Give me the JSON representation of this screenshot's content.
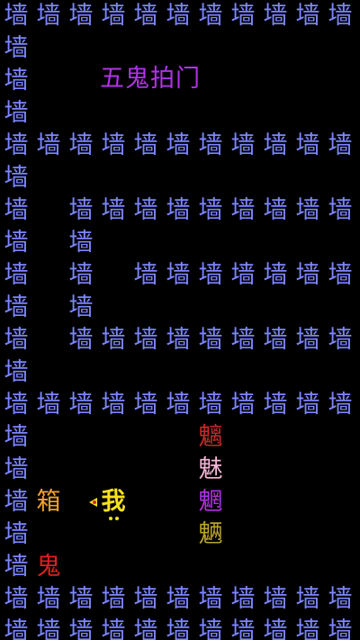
{
  "title": "五鬼拍门",
  "wall_char": "墙",
  "walls": [
    [
      0,
      0
    ],
    [
      1,
      0
    ],
    [
      2,
      0
    ],
    [
      3,
      0
    ],
    [
      4,
      0
    ],
    [
      5,
      0
    ],
    [
      6,
      0
    ],
    [
      7,
      0
    ],
    [
      8,
      0
    ],
    [
      9,
      0
    ],
    [
      10,
      0
    ],
    [
      0,
      1
    ],
    [
      0,
      2
    ],
    [
      0,
      3
    ],
    [
      0,
      4
    ],
    [
      1,
      4
    ],
    [
      2,
      4
    ],
    [
      3,
      4
    ],
    [
      4,
      4
    ],
    [
      5,
      4
    ],
    [
      6,
      4
    ],
    [
      7,
      4
    ],
    [
      8,
      4
    ],
    [
      9,
      4
    ],
    [
      10,
      4
    ],
    [
      0,
      5
    ],
    [
      0,
      6
    ],
    [
      2,
      6
    ],
    [
      3,
      6
    ],
    [
      4,
      6
    ],
    [
      5,
      6
    ],
    [
      6,
      6
    ],
    [
      7,
      6
    ],
    [
      8,
      6
    ],
    [
      9,
      6
    ],
    [
      10,
      6
    ],
    [
      0,
      7
    ],
    [
      2,
      7
    ],
    [
      0,
      8
    ],
    [
      2,
      8
    ],
    [
      4,
      8
    ],
    [
      5,
      8
    ],
    [
      6,
      8
    ],
    [
      7,
      8
    ],
    [
      8,
      8
    ],
    [
      9,
      8
    ],
    [
      10,
      8
    ],
    [
      0,
      9
    ],
    [
      2,
      9
    ],
    [
      0,
      10
    ],
    [
      2,
      10
    ],
    [
      3,
      10
    ],
    [
      4,
      10
    ],
    [
      5,
      10
    ],
    [
      6,
      10
    ],
    [
      7,
      10
    ],
    [
      8,
      10
    ],
    [
      9,
      10
    ],
    [
      10,
      10
    ],
    [
      0,
      11
    ],
    [
      0,
      12
    ],
    [
      1,
      12
    ],
    [
      2,
      12
    ],
    [
      3,
      12
    ],
    [
      4,
      12
    ],
    [
      5,
      12
    ],
    [
      6,
      12
    ],
    [
      7,
      12
    ],
    [
      8,
      12
    ],
    [
      9,
      12
    ],
    [
      10,
      12
    ],
    [
      0,
      13
    ],
    [
      0,
      14
    ],
    [
      0,
      15
    ],
    [
      0,
      16
    ],
    [
      0,
      17
    ],
    [
      0,
      18
    ],
    [
      1,
      18
    ],
    [
      2,
      18
    ],
    [
      3,
      18
    ],
    [
      4,
      18
    ],
    [
      5,
      18
    ],
    [
      6,
      18
    ],
    [
      7,
      18
    ],
    [
      8,
      18
    ],
    [
      9,
      18
    ],
    [
      10,
      18
    ],
    [
      0,
      19
    ],
    [
      1,
      19
    ],
    [
      2,
      19
    ],
    [
      3,
      19
    ],
    [
      4,
      19
    ],
    [
      5,
      19
    ],
    [
      6,
      19
    ],
    [
      7,
      19
    ],
    [
      8,
      19
    ],
    [
      9,
      19
    ],
    [
      10,
      19
    ]
  ],
  "entities": [
    {
      "name": "ghost-chi",
      "char": "魑",
      "color": "#c42b2b",
      "col": 6,
      "row": 13
    },
    {
      "name": "ghost-mei",
      "char": "魅",
      "color": "#f4b7d6",
      "col": 6,
      "row": 14
    },
    {
      "name": "ghost-wang",
      "char": "魍",
      "color": "#b233e6",
      "col": 6,
      "row": 15
    },
    {
      "name": "ghost-liang",
      "char": "魉",
      "color": "#b9a32a",
      "col": 6,
      "row": 16
    },
    {
      "name": "box",
      "char": "箱",
      "color": "#f0a030",
      "col": 1,
      "row": 15
    },
    {
      "name": "ghost-red",
      "char": "鬼",
      "color": "#e02020",
      "col": 1,
      "row": 17
    }
  ],
  "player": {
    "char": "我",
    "color": "#f6e21a",
    "col": 3,
    "row": 15
  }
}
